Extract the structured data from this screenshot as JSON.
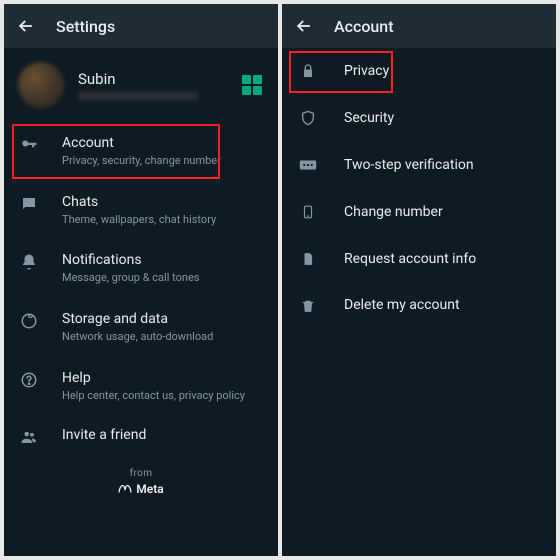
{
  "left": {
    "header": "Settings",
    "profile": {
      "name": "Subin"
    },
    "items": [
      {
        "title": "Account",
        "sub": "Privacy, security, change number"
      },
      {
        "title": "Chats",
        "sub": "Theme, wallpapers, chat history"
      },
      {
        "title": "Notifications",
        "sub": "Message, group & call tones"
      },
      {
        "title": "Storage and data",
        "sub": "Network usage, auto-download"
      },
      {
        "title": "Help",
        "sub": "Help center, contact us, privacy policy"
      },
      {
        "title": "Invite a friend"
      }
    ],
    "footer_from": "from",
    "footer_brand": "Meta"
  },
  "right": {
    "header": "Account",
    "items": [
      {
        "title": "Privacy"
      },
      {
        "title": "Security"
      },
      {
        "title": "Two-step verification"
      },
      {
        "title": "Change number"
      },
      {
        "title": "Request account info"
      },
      {
        "title": "Delete my account"
      }
    ]
  }
}
